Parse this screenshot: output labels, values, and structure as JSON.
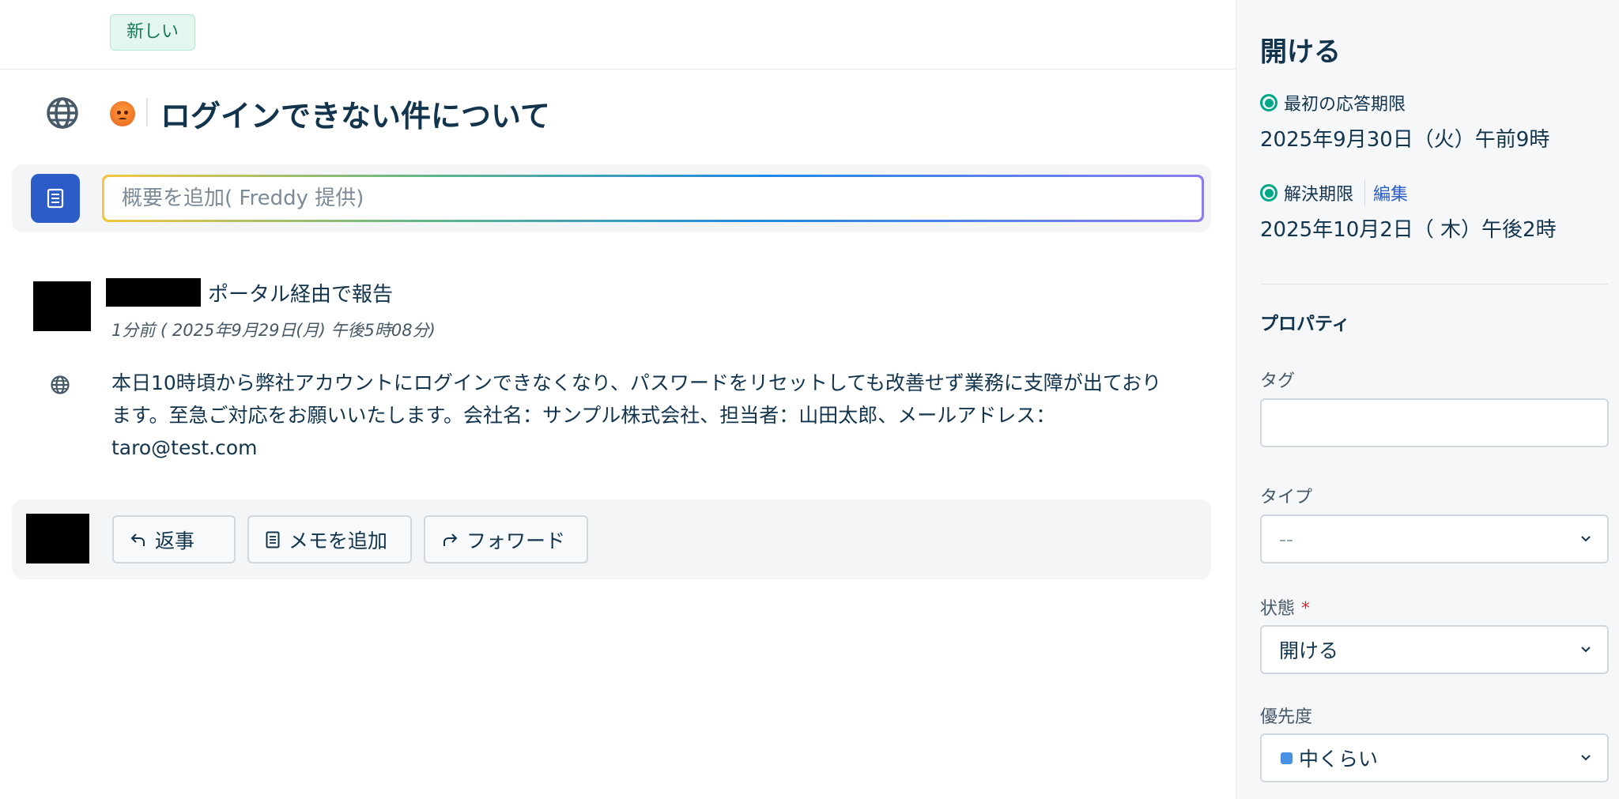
{
  "ticket": {
    "badge": "新しい",
    "title": "ログインできない件について",
    "summary_placeholder": "概要を追加( Freddy 提供)"
  },
  "message": {
    "via": "ポータル経由で報告",
    "time": "1分前 ( 2025年9月29日(月) 午後5時08分)",
    "body": "本日10時頃から弊社アカウントにログインできなくなり、パスワードをリセットしても改善せず業務に支障が出ております。至急ご対応をお願いいたします。会社名：サンプル株式会社、担当者：山田太郎、メールアドレス：taro@test.com"
  },
  "actions": {
    "reply": "返事",
    "add_note": "メモを追加",
    "forward": "フォワード"
  },
  "sidebar": {
    "status_heading": "開ける",
    "first_response_label": "最初の応答期限",
    "first_response_date": "2025年9月30日（火）午前9時",
    "resolution_label": "解決期限",
    "resolution_edit": "編集",
    "resolution_date": "2025年10月2日（ 木）午後2時",
    "properties_heading": "プロパティ",
    "tag_label": "タグ",
    "tag_value": "",
    "type_label": "タイプ",
    "type_value": "--",
    "status_label": "状態",
    "status_required": "*",
    "status_value": "開ける",
    "priority_label": "優先度",
    "priority_value": "中くらい"
  },
  "colors": {
    "accent": "#2c5cc5",
    "sla_ok": "#00a886",
    "priority_medium": "#4a90e2",
    "badge_bg": "#e3f7ef",
    "required": "#d72d30"
  },
  "icons": {
    "source": "globe-icon",
    "sentiment": "angry-face-icon",
    "summary": "document-icon",
    "reply": "reply-arrow-icon",
    "note": "note-icon",
    "forward": "forward-arrow-icon",
    "dropdown": "chevron-down-icon"
  }
}
